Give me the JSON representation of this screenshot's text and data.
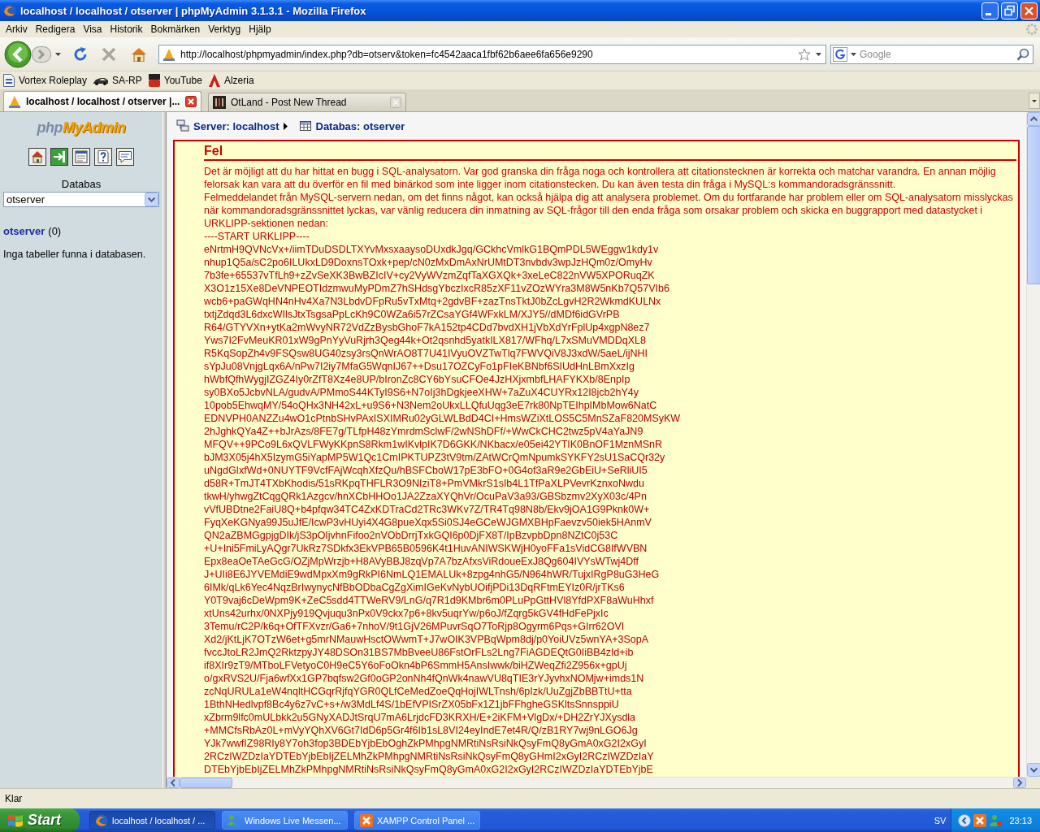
{
  "window": {
    "title": "localhost / localhost / otserver | phpMyAdmin 3.1.3.1 - Mozilla Firefox"
  },
  "menu": [
    "Arkiv",
    "Redigera",
    "Visa",
    "Historik",
    "Bokmärken",
    "Verktyg",
    "Hjälp"
  ],
  "address_bar": {
    "value": "http://localhost/phpmyadmin/index.php?db=otserv&token=fc4542aaca1fbf62b6aee6fa656e9290"
  },
  "search": {
    "placeholder": "Google"
  },
  "bookmarks": [
    "Vortex Roleplay",
    "SA-RP",
    "YouTube",
    "Alzeria"
  ],
  "tabs": [
    {
      "label": "localhost / localhost / otserver |...",
      "selected": true
    },
    {
      "label": "OtLand - Post New Thread",
      "selected": false
    }
  ],
  "sidebar": {
    "logo": {
      "prefix": "php",
      "name": "MyAdmin"
    },
    "database_label": "Databas",
    "database_select": {
      "value": "otserver"
    },
    "database_link": {
      "name": "otserver",
      "count": "(0)"
    },
    "message": "Inga tabeller funna i databasen."
  },
  "breadcrumb": [
    "Server: localhost",
    "Databas: otserver"
  ],
  "error": {
    "title": "Fel",
    "paragraphs": [
      "Det är möjligt att du har hittat en bugg i SQL-analysatorn. Var god granska din fråga noga och kontrollera att citationstecknen är korrekta och matchar varandra. En annan möjlig felorsak kan vara att du överför en fil med binärkod som inte ligger inom citationstecken. Du kan även testa din fråga i MySQL:s kommandoradsgränssnitt.",
      "Felmeddelandet från MySQL-servern nedan, om det finns något, kan också hjälpa dig att analysera problemet. Om du fortfarande har problem eller om SQL-analysatorn misslyckas när kommandoradsgränssnittet lyckas, var vänlig reducera din inmatning av SQL-frågor till den enda fråga som orsakar problem och skicka en buggrapport med datastycket i URKLIPP-sektionen nedan:"
    ],
    "clip_start": "----START URKLIPP----",
    "clip_lines": [
      "eNrtmH9QVNcVx+/iimTDuDSDLTXYvMxsxaaysoDUxdkJgq/GCkhcVmlkG1BQmPDL5WEggw1kdy1v",
      "nhup1Q5a/sC2po6ILUkxLD9DoxnsTOxk+pep/cN0zMxDmAxNrUMtDT3nvbdv3wpJzHQm0z/OmyHv",
      "7b3fe+65537vTfLh9+zZvSeXK3BwBZIcIV+cy2VyWVzmZqfTaXGXQk+3xeLeC822nVW5XPORuqZK",
      "X3O1z15Xe8DeVNPEOTIdzmwuMyPDmZ7hSHdsgYbczIxcR85zXF11vZOzWYra3M8W5nKb7Q57VIb6",
      "wcb6+paGWqHN4nHv4Xa7N3LbdvDFpRu5vTxMtq+2gdvBF+zazTnsTktJ0bZcLgvH2R2WkmdKULNx",
      "txtjZdqd3L6dxcWIlsJtxTsgsaPpLcKh9C0WZa6i57rZCsaYGf4WFxkLM/XJY5//dMDf6idGVrPB",
      "R64/GTYVXn+ytKa2mWvyNR72VdZzBysbGhoF7kA152tp4CDd7bvdXH1jVbXdYrFplUp4xgpN8ez7",
      "Yws7I2FvMeuKR01xW9gPnYyVuRjrh3Qeg44k+Ot2qsnhd5yatkILX817/WFhq/L7xSMuVMDDqXL8",
      "R5KqSopZh4v9FSQsw8UG40zsy3rsQnWrAO8T7U41IVyuOVZTwTlq7FWVQiV8J3xdW/5aeL/ijNHI",
      "sYpJu08VnjgLqx6A/nPw7I2iy7MfaG5WqnIJ67++Dsu17OZCyFo1pFIeKBNbf6SIUdHnLBmXxzIg",
      "hWbfQfhWygjIZGZ4Iy0rZfT8Xz4e8UP/bIronZc8CY6bYsuCFOe4JzHXjxmbfLHAFYKXb/8EnpIp",
      "sy0BXo5JcbvNLA/gudvA/PMmoS44KTyI9S6+N7oIj3hDgkjeeXHW+7aZuX4CUYRx12I8jcb2hY4y",
      "10pob5EhwqMY/54oQHx3NH42xL+u9S6+N3Nem2oUkxLLQfuUqg3eE7rk80NpTEIhpIMbMow6NatC",
      "EDNVPH0ANZZu4wO1cPtnbSHvPAxISXIMRu02yGLWLBdD4CI+HmsWZiXtLOS5C5MnSZaF820MSyKW",
      "2hJghkQYa4Z++bJrAzs/8FE7g/TLfpH48zYmrdmSclwF/2wNShDFf/+WwCkCHC2twz5pV4aYaJN9",
      "MFQV++9PCo9L6xQVLFWyKKpnS8Rkm1wIKvlpIK7D6GKK/NKbacx/e05ei42YTIK0BnOF1MznMSnR",
      "bJM3X05j4hX5IzymG5iYapMP5W1Qc1CmIPKTUPZ3tV9tm/ZAtWCrQmNpumkSYKFY2sU1SaCQr32y",
      "uNgdGIxfWd+0NUYTF9VcfFAjWcqhXfzQu/hBSFCboW17pE3bFO+0G4of3aR9e2GbEiU+SeRliUI5",
      "d58R+TmJT4TXbKhodis/51sRKpqTHFLR3O9NIziT8+PmVMkrS1sIb4L1TfPaXLPVevrKznxoNwdu",
      "tkwH/yhwgZtCqgQRk1Azgcv/hnXCbHHOo1JA2ZzaXYQhVr/OcuPaV3a93/GBSbzmv2XyX03c/4Pn",
      "vVfUBDtne2FaiU8Q+b4pfqw34TC4ZxKDTraCd2TRc3WKv7Z/TR4Tq98N8b/Ekv9jOA1G9Pknk0W+",
      "FyqXeKGNya99J5uJfE/IcwP3vHUyi4X4G8pueXqx5Si0SJ4eGCeWJGMXBHpFaevzv50iek5HAnmV",
      "QN2aZBMGgpjgDIk/jS3pOIjvhnFifoo2nVObDrrjTxkGQI6p0DjFX8T/IpBzvpbDpn8NZtC0j53C",
      "+U+Ini5FmiLyAQgr7UkRz7SDkfx3EkVPB65B0596K4t1HuvANIWSKWjH0yoFFa1sVidCG8IfWVBN",
      "Epx8eaOeTAeGcG/OZjMpWrzjb+H8AVyBBJ8zqVp7A7bzAfxsViRdoueExJ8Qg604IVYsWTwj4Dff",
      "J+UIi8E6JYVEMdiE9wdMpxXm9gRkPI6NmLQ1EMALUk+8zpg4nhG5/N964hWR/TujxIRgP8uG3HeG",
      "6IMk/qLk6Yec4NqzBrIwynycNfBbODbaCgZgXimIGeKvNybUOifjPDi13DqRFtmEYIz0R/jrTKs6",
      "Y0T9vaj6cDeWpm9K+ZeC5sdd4TTWeRV9/LnG/q7R1d9KMbr6m0PLuPpGttHVl8YfdPXF8aWuHhxf",
      "xtUns42urhx/0NXPjy919Qvjuqu3nPx0V9ckx7p6+8kv5uqrYw/p6oJ/fZqrg5kGV4fHdFePjxIc",
      "3Temu/rC2P/k6q+OfTFXvzr/Ga6+7nhoV/9t1GjV26MPuvrSqO7ToRjp8Ogyrm6Pqs+GIrr62OVI",
      "Xd2/jKtLjK7OTzW6et+g5mrNMauwHsctOWwmT+J7wOIK3VPBqWpm8dj/p0YoiUVz5wnYA+3SopA",
      "fvccJtoLR2JmQ2RktzpyJY48DSOn31BS7MbBveeU86FstOrFLs2Lng7FiAGDEQtG0IiBB4zId+ib",
      "if8XIr9zT9/MTboLFVetyoC0H9eC5Y6oFoOkn4bP6SmmH5AnsIwwk/biHZWeqZfi2Z956x+gpUj",
      "o/gxRVS2U/Fja6wfXx1GP7bqfsw2Gf0oGP2onNh4fQnWk4nawVU8qTIE3rYJyvhxNOMjw+imds1N",
      "zcNqURULa1eW4nqltHCGqrRjfqYGR0QLfCeMedZoeQqHojIWLTnsh/6pIzk/UuZgjZbBBTtU+tta",
      "1BthNHedlvpf8Bc4y6z7vC+s+/w3MdLf4S/1bEfVPISrZX05bFx1Z1jbFFhgheGSKltsSnnsppiU",
      "xZbrm9lfc0mULbkk2u5GNyXADJtSrqU7mA6LrjdcFD3KRXH/E+2iKFM+VlgDx/+DH2ZrYJXysdla",
      "+MMCfsRbAz0L+mVyYQhXV6Gt7IdD6p5Gr4f6Ib1sL8VI24eyIndE7et4R/Q/zB1RY7wj9nLGO6Jg",
      "YJk7wwfIZ98RIy8Y7oh3fop3BDEbYjbEbOghZkPMhpgNMRtiNsRsiNkQsyFmQ8yGmA0xG2I2xGyI",
      "2RCzIWZDzIaYDTEbYjbEbIjZELMhZkPMhpgNMRtiNsRsiNkQsyFmQ8yGHmI2xGyI2RCzIWZDzIaY",
      "DTEbYjbEbIjZELMhZkPMhpgNMRtiNsRsiNkQsyFmQ8yGmA0xG2I2xGyI2RCzIWZDzIaYDTEbYjbE"
    ]
  },
  "status_bar": {
    "text": "Klar"
  },
  "taskbar": {
    "start": "Start",
    "items": [
      {
        "label": "localhost / localhost / ...",
        "selected": true
      },
      {
        "label": "Windows Live Messen...",
        "selected": false
      },
      {
        "label": "XAMPP Control Panel ...",
        "selected": false
      }
    ],
    "language": "SV",
    "clock": "23:13"
  }
}
